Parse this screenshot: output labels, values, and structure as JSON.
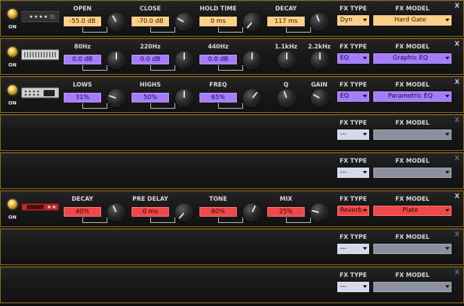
{
  "common": {
    "on_label": "ON",
    "fx_type_label": "FX TYPE",
    "fx_model_label": "FX MODEL",
    "close_symbol": "X",
    "empty_type": "---"
  },
  "slots": [
    {
      "thumb_color": "#2a2a2a",
      "params": [
        {
          "label": "OPEN",
          "value": "-55.0 dB",
          "knob": true
        },
        {
          "label": "CLOSE",
          "value": "-70.0 dB",
          "knob": true
        },
        {
          "label": "HOLD TIME",
          "value": "0 ms",
          "knob": true
        },
        {
          "label": "DECAY",
          "value": "117 ms",
          "knob": true
        }
      ],
      "fx_type": "Dyn",
      "fx_model": "Hard Gate",
      "theme": "amber"
    },
    {
      "thumb_color": "#cfcfcf",
      "params": [
        {
          "label": "80Hz",
          "value": "0.0 dB",
          "knob": true
        },
        {
          "label": "220Hz",
          "value": "0.0 dB",
          "knob": true
        },
        {
          "label": "440Hz",
          "value": "0.0 dB",
          "knob": true
        },
        {
          "label": "1.1kHz",
          "value": "",
          "knob": true
        },
        {
          "label": "2.2kHz",
          "value": "",
          "knob": true
        }
      ],
      "fx_type": "EQ",
      "fx_model": "Graphic EQ",
      "theme": "purple"
    },
    {
      "thumb_color": "#cfcfcf",
      "params": [
        {
          "label": "LOWS",
          "value": "31%",
          "knob": true
        },
        {
          "label": "HIGHS",
          "value": "50%",
          "knob": true
        },
        {
          "label": "FREQ",
          "value": "65%",
          "knob": true
        },
        {
          "label": "Q",
          "value": "",
          "knob": true
        },
        {
          "label": "GAIN",
          "value": "",
          "knob": true
        }
      ],
      "fx_type": "EQ",
      "fx_model": "Parametric EQ",
      "theme": "purple"
    },
    {
      "empty": true,
      "fx_type": "---",
      "fx_model": ""
    },
    {
      "empty": true,
      "fx_type": "---",
      "fx_model": ""
    },
    {
      "thumb_color": "#c83030",
      "params": [
        {
          "label": "DECAY",
          "value": "40%",
          "knob": true
        },
        {
          "label": "PRE DELAY",
          "value": "0 ms",
          "knob": true
        },
        {
          "label": "TONE",
          "value": "60%",
          "knob": true
        },
        {
          "label": "MIX",
          "value": "25%",
          "knob": true
        }
      ],
      "fx_type": "Reverb",
      "fx_model": "Plate",
      "theme": "red"
    },
    {
      "empty": true,
      "fx_type": "---",
      "fx_model": ""
    },
    {
      "empty": true,
      "fx_type": "---",
      "fx_model": ""
    }
  ]
}
